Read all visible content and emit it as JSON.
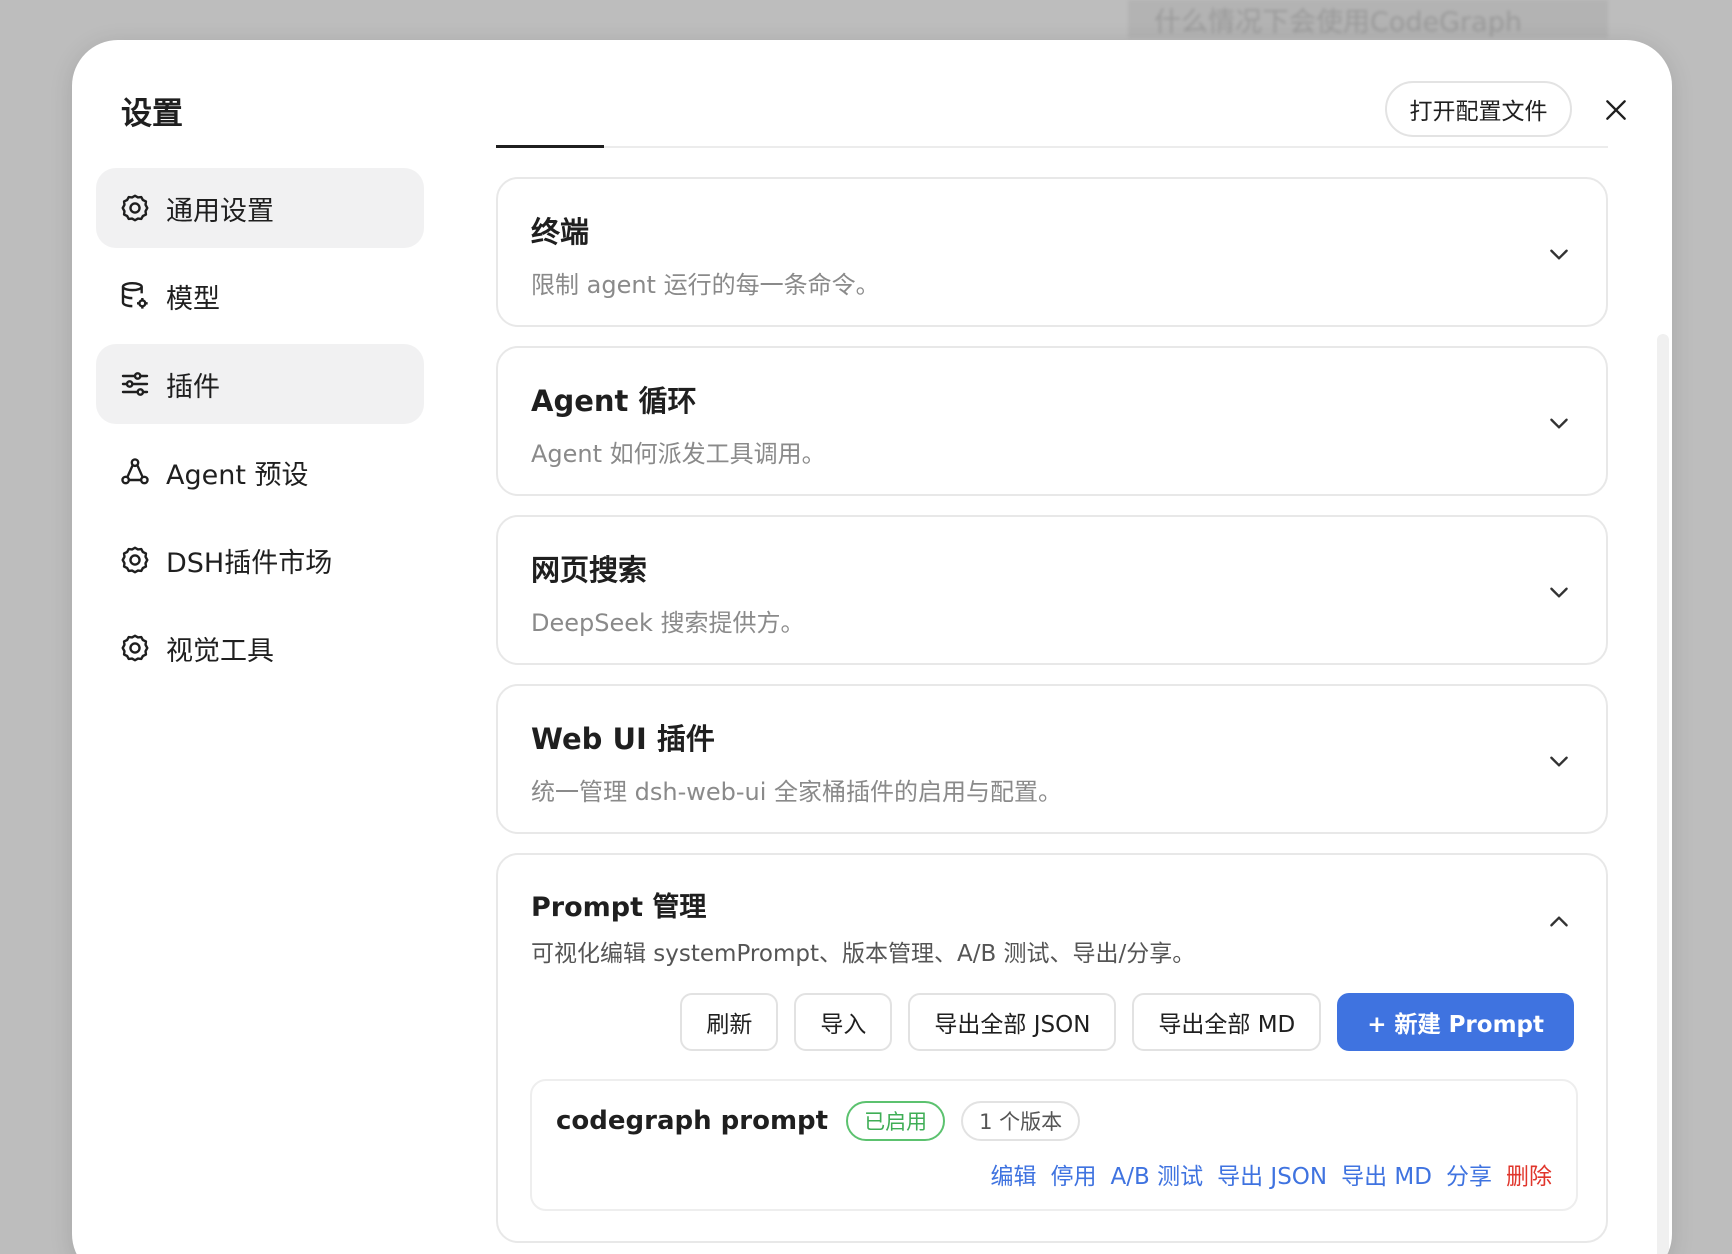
{
  "background": {
    "hint_text": "什么情况下会使用CodeGraph"
  },
  "modal": {
    "title": "设置",
    "open_config_label": "打开配置文件"
  },
  "sidebar": {
    "items": [
      {
        "label": "通用设置",
        "icon": "gear-icon",
        "active": true
      },
      {
        "label": "模型",
        "icon": "database-gear-icon",
        "active": false
      },
      {
        "label": "插件",
        "icon": "sliders-icon",
        "active": true
      },
      {
        "label": "Agent 预设",
        "icon": "network-icon",
        "active": false
      },
      {
        "label": "DSH插件市场",
        "icon": "gear-icon",
        "active": false
      },
      {
        "label": "视觉工具",
        "icon": "gear-icon",
        "active": false
      }
    ]
  },
  "sections": [
    {
      "title": "终端",
      "desc": "限制 agent 运行的每一条命令。"
    },
    {
      "title": "Agent 循环",
      "desc": "Agent 如何派发工具调用。"
    },
    {
      "title": "网页搜索",
      "desc": "DeepSeek 搜索提供方。"
    },
    {
      "title": "Web UI 插件",
      "desc": "统一管理 dsh-web-ui 全家桶插件的启用与配置。"
    }
  ],
  "prompt_section": {
    "title": "Prompt 管理",
    "desc": "可视化编辑 systemPrompt、版本管理、A/B 测试、导出/分享。",
    "toolbar": {
      "refresh": "刷新",
      "import": "导入",
      "export_json": "导出全部 JSON",
      "export_md": "导出全部 MD",
      "new_prompt": "+ 新建 Prompt"
    },
    "items": [
      {
        "name": "codegraph prompt",
        "status": "已启用",
        "versions": "1 个版本",
        "actions": {
          "edit": "编辑",
          "disable": "停用",
          "ab_test": "A/B 测试",
          "export_json": "导出 JSON",
          "export_md": "导出 MD",
          "share": "分享",
          "delete": "删除"
        }
      }
    ]
  },
  "colors": {
    "primary": "#3f73e0",
    "enabled": "#3fae56",
    "danger": "#e0352b",
    "active_bg": "#f1f1f2"
  }
}
